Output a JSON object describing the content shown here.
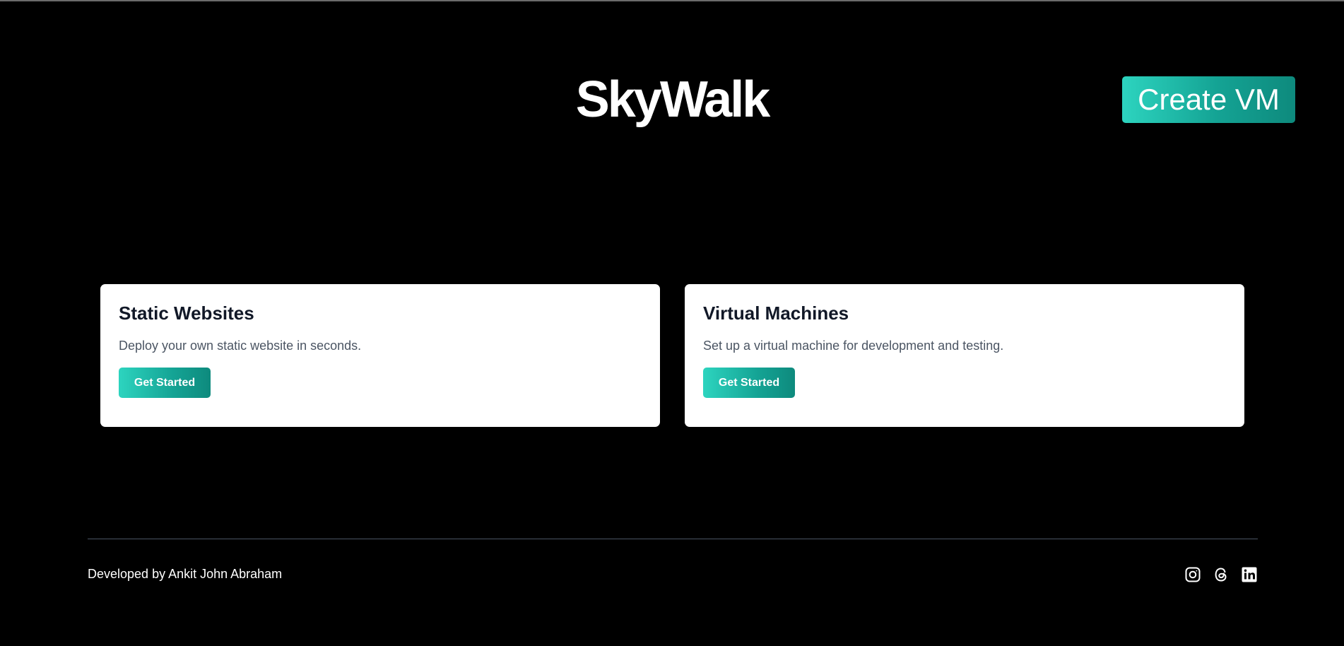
{
  "header": {
    "brand": "SkyWalk",
    "create_vm_label": "Create VM"
  },
  "cards": [
    {
      "title": "Static Websites",
      "description": "Deploy your own static website in seconds.",
      "button_label": "Get Started"
    },
    {
      "title": "Virtual Machines",
      "description": "Set up a virtual machine for development and testing.",
      "button_label": "Get Started"
    }
  ],
  "footer": {
    "credit": "Developed by Ankit John Abraham",
    "social_icons": [
      "instagram-icon",
      "threads-icon",
      "linkedin-icon"
    ]
  },
  "colors": {
    "background": "#000000",
    "accent_start": "#2dd4bf",
    "accent_end": "#0e8a7d",
    "card_bg": "#ffffff",
    "divider": "#4b5563"
  }
}
